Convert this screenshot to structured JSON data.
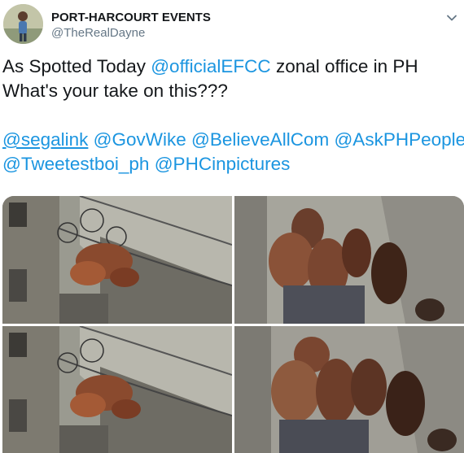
{
  "tweet": {
    "display_name": "PORT-HARCOURT EVENTS",
    "handle": "@TheRealDayne",
    "line1": {
      "prefix": "As Spotted Today ",
      "mention": "@officialEFCC",
      "suffix": " zonal office in PH"
    },
    "line2": "What's your take on this???",
    "mentions_row1": [
      "@segalink",
      "@GovWike",
      "@BelieveAllCom",
      "@AskPHPeople"
    ],
    "mentions_row2": [
      "@Tweetestboi_ph",
      "@PHCinpictures"
    ],
    "photo_count": 4
  },
  "colors": {
    "text": "#14171a",
    "secondary": "#657786",
    "link": "#1b95e0"
  },
  "icons": {
    "menu": "chevron-down-icon"
  }
}
